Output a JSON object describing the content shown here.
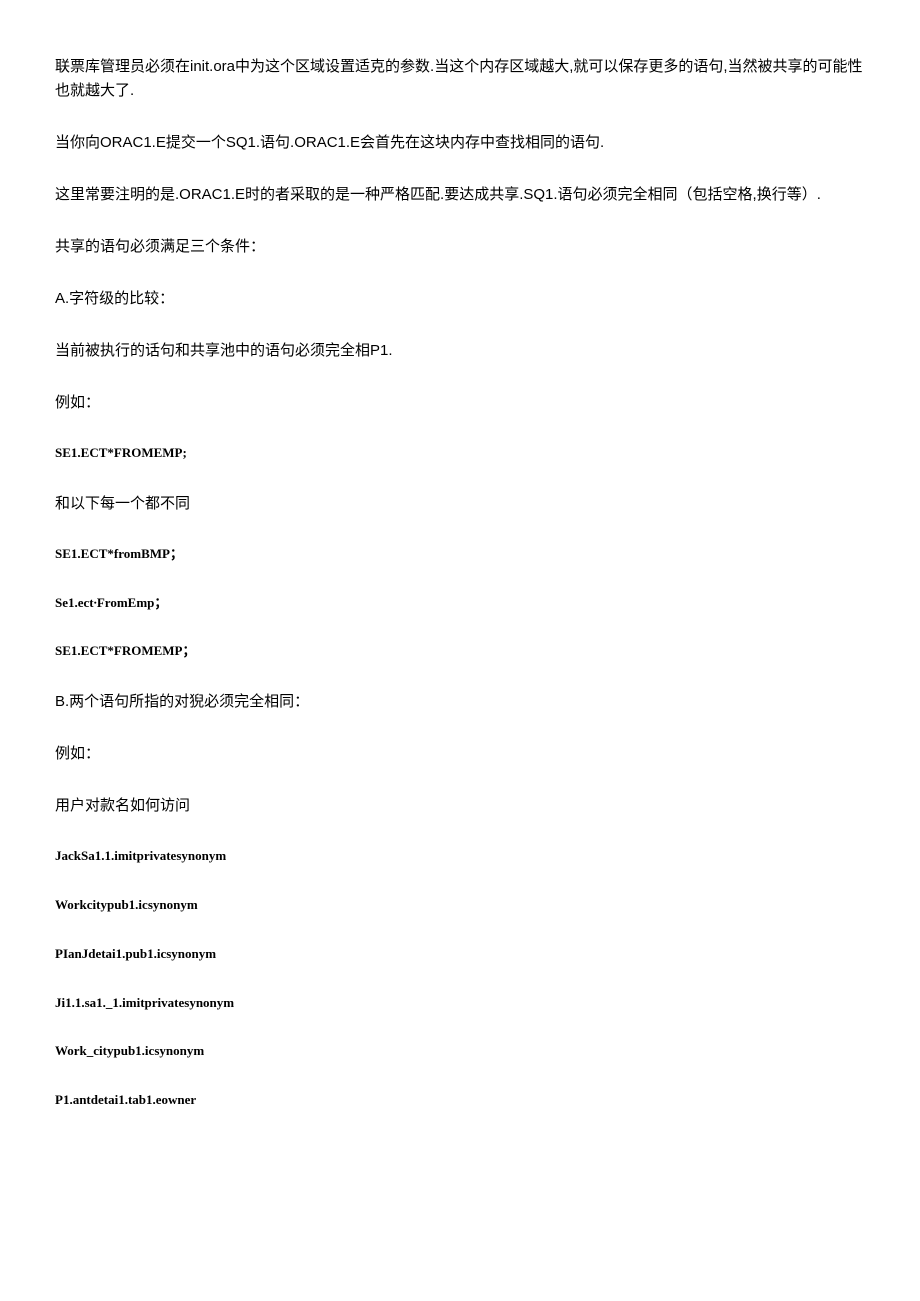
{
  "paragraphs": {
    "p1": "联票库管理员必须在init.ora中为这个区域设置适克的参数.当这个内存区域越大,就可以保存更多的语句,当然被共享的可能性也就越大了.",
    "p2": "当你向ORAC1.E提交一个SQ1.语句.ORAC1.E会首先在这块内存中查找相同的语句.",
    "p3": "这里常要注明的是.ORAC1.E时的者采取的是一种严格匹配.要达成共享.SQ1.语句必须完全相同（包括空格,换行等）.",
    "p4": "共享的语句必须满足三个条件：",
    "p5": "A.字符级的比较：",
    "p6": "当前被执行的话句和共享池中的语句必须完全相P1.",
    "p7": "例如：",
    "p8": "SE1.ECT*FROMEMP;",
    "p9": "和以下每一个都不同",
    "p10": "SE1.ECT*fromBMP；",
    "p11": "Se1.ect∙FromEmp；",
    "p12": "SE1.ECT*FROMEMP；",
    "p13": "B.两个语句所指的对猊必须完全相同：",
    "p14": "例如：",
    "p15": "用户对款名如何访问",
    "p16": "JackSa1.1.imitprivatesynonym",
    "p17": "Workcitypub1.icsynonym",
    "p18": "PIanJdetai1.pub1.icsynonym",
    "p19": "Ji1.1.sa1._1.imitprivatesynonym",
    "p20": "Work_citypub1.icsynonym",
    "p21": "P1.antdetai1.tab1.eowner"
  }
}
